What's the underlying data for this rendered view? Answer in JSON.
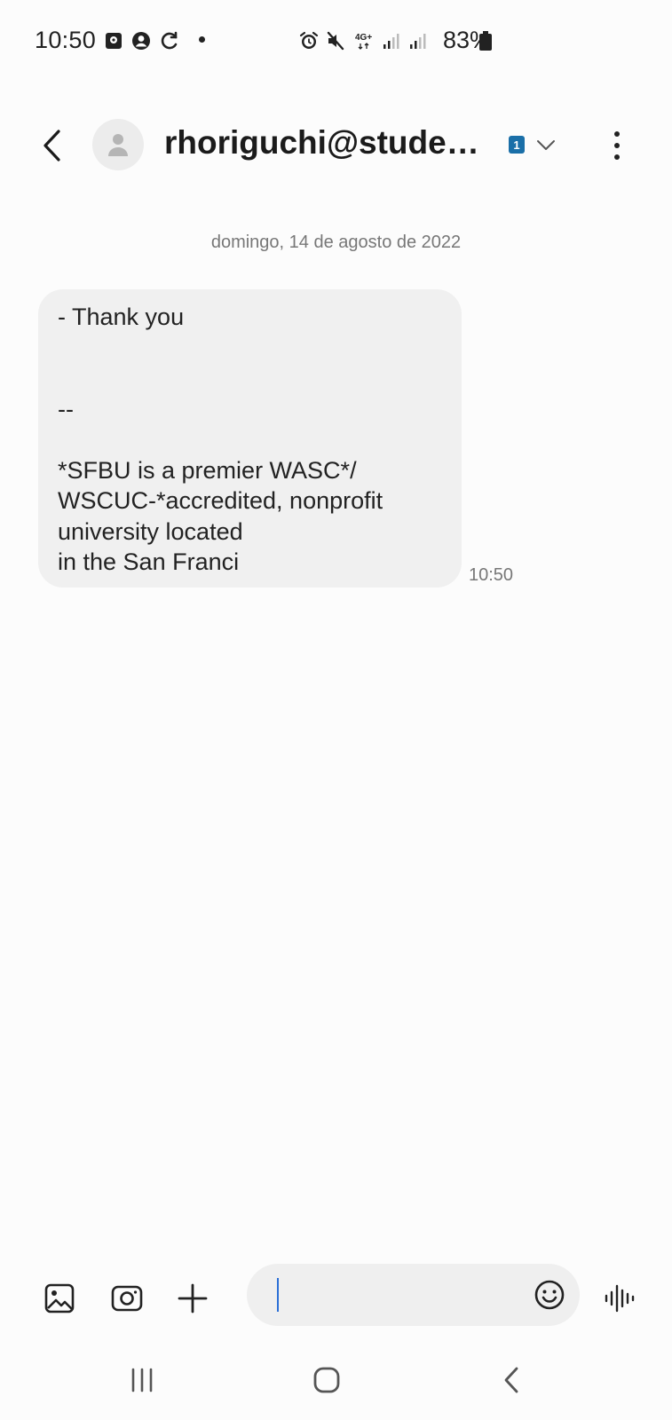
{
  "status_bar": {
    "time": "10:50",
    "battery": "83%",
    "network": "4G+",
    "icons": [
      "sd-card-icon",
      "account-circle-icon",
      "sync-icon",
      "notification-dot-icon",
      "alarm-icon",
      "mute-icon",
      "network-4g-icon",
      "signal-icon",
      "signal-icon",
      "battery-icon"
    ]
  },
  "header": {
    "contact": "rhoriguchi@student…",
    "sim_badge": "1",
    "icons": [
      "back-icon",
      "person-icon",
      "sim-badge-icon",
      "chevron-down-icon",
      "more-vert-icon"
    ]
  },
  "conversation": {
    "date": "domingo, 14 de agosto de 2022",
    "messages": [
      {
        "direction": "incoming",
        "text": "- Thank you\n\n\n--\n\n*SFBU is a premier WASC*/\nWSCUC-*accredited, nonprofit\nuniversity located\nin the San Franci",
        "time": "10:50"
      }
    ]
  },
  "composer": {
    "value": "",
    "placeholder": "",
    "icons": [
      "gallery-icon",
      "camera-icon",
      "plus-icon",
      "emoji-icon",
      "voice-wave-icon"
    ]
  },
  "nav_bar": {
    "icons": [
      "recents-icon",
      "home-icon",
      "back-nav-icon"
    ]
  },
  "colors": {
    "background": "#fcfcfc",
    "bubble": "#f0f0f0",
    "caret": "#2b6fd6",
    "sim_badge": "#1a6fa8"
  }
}
